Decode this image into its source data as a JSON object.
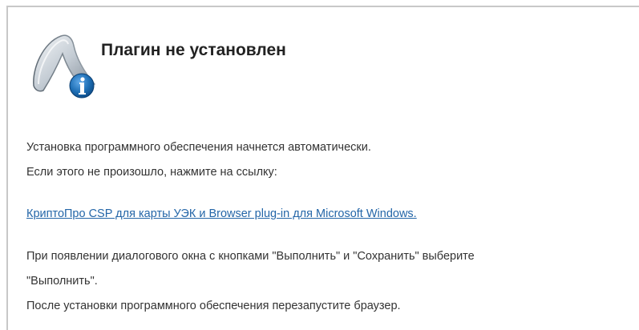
{
  "notice": {
    "icon": "info-app-icon",
    "title": "Плагин не установлен",
    "line_auto_install": "Установка программного обеспечения начнется автоматически.",
    "line_if_not": "Если этого не произошло, нажмите на ссылку:",
    "download_link": "КриптоПро CSP для карты УЭК и Browser plug-in для Microsoft Windows.",
    "line_dialog": "При появлении диалогового окна с кнопками \"Выполнить\" и \"Сохранить\" выберите",
    "line_dialog_cont": "\"Выполнить\".",
    "line_restart": "После установки программного обеспечения перезапустите браузер."
  },
  "colors": {
    "link": "#2466a8",
    "border": "#c8c8c8",
    "info_badge": "#1e6fb5"
  }
}
